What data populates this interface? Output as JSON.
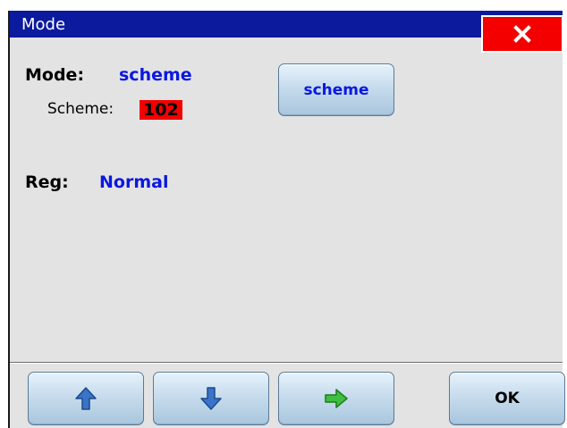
{
  "window": {
    "title": "Mode",
    "close_label": "X"
  },
  "mode": {
    "label": "Mode:",
    "value": "scheme",
    "scheme_label": "Scheme:",
    "scheme_number": "102",
    "scheme_button_label": "scheme"
  },
  "reg": {
    "label": "Reg:",
    "value": "Normal"
  },
  "footer": {
    "up_icon": "arrow-up-icon",
    "down_icon": "arrow-down-icon",
    "right_icon": "arrow-right-icon",
    "ok_label": "OK"
  },
  "colors": {
    "titlebar": "#0c1a9e",
    "close_button": "#f40000",
    "value_text": "#0a18e0",
    "scheme_badge": "#f30000",
    "arrow_blue": "#3a73c8",
    "arrow_green": "#3fbf3f"
  }
}
